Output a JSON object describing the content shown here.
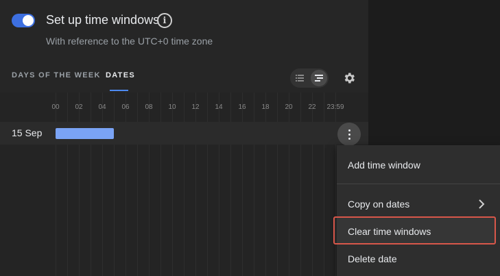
{
  "header": {
    "toggle_on": true,
    "title": "Set up time windows",
    "subtitle": "With reference to the UTC+0 time zone"
  },
  "tabs": [
    {
      "label": "DAYS OF THE WEEK",
      "active": false
    },
    {
      "label": "DATES",
      "active": true
    }
  ],
  "timeline": {
    "hours": [
      "00",
      "02",
      "04",
      "06",
      "08",
      "10",
      "12",
      "14",
      "16",
      "18",
      "20",
      "22",
      "23:59"
    ],
    "rows": [
      {
        "date": "15 Sep",
        "window_start_hour": 0,
        "window_end_hour": 5
      }
    ]
  },
  "menu": {
    "items": [
      "Add time window",
      "Copy on dates",
      "Clear time windows",
      "Delete date"
    ]
  },
  "colors": {
    "accent": "#3d6fe0",
    "bar": "#7aa3f5",
    "highlight": "#d9574a"
  }
}
